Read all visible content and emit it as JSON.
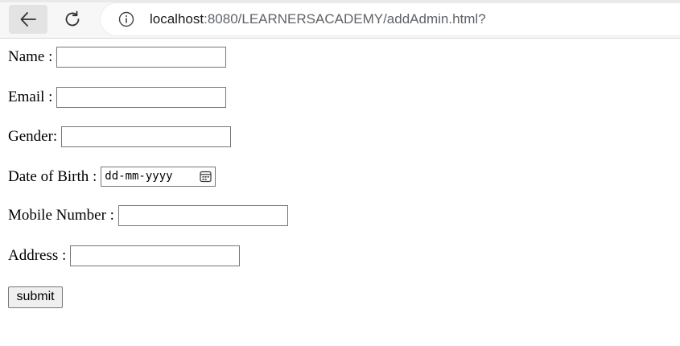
{
  "browser": {
    "url_host": "localhost",
    "url_path": ":8080/LEARNERSACADEMY/addAdmin.html?"
  },
  "form": {
    "name_label": "Name :",
    "email_label": "Email :",
    "gender_label": "Gender:",
    "dob_label": "Date of Birth :",
    "dob_placeholder": "dd-mm-yyyy",
    "mobile_label": "Mobile Number :",
    "address_label": "Address :",
    "submit_label": "submit"
  }
}
